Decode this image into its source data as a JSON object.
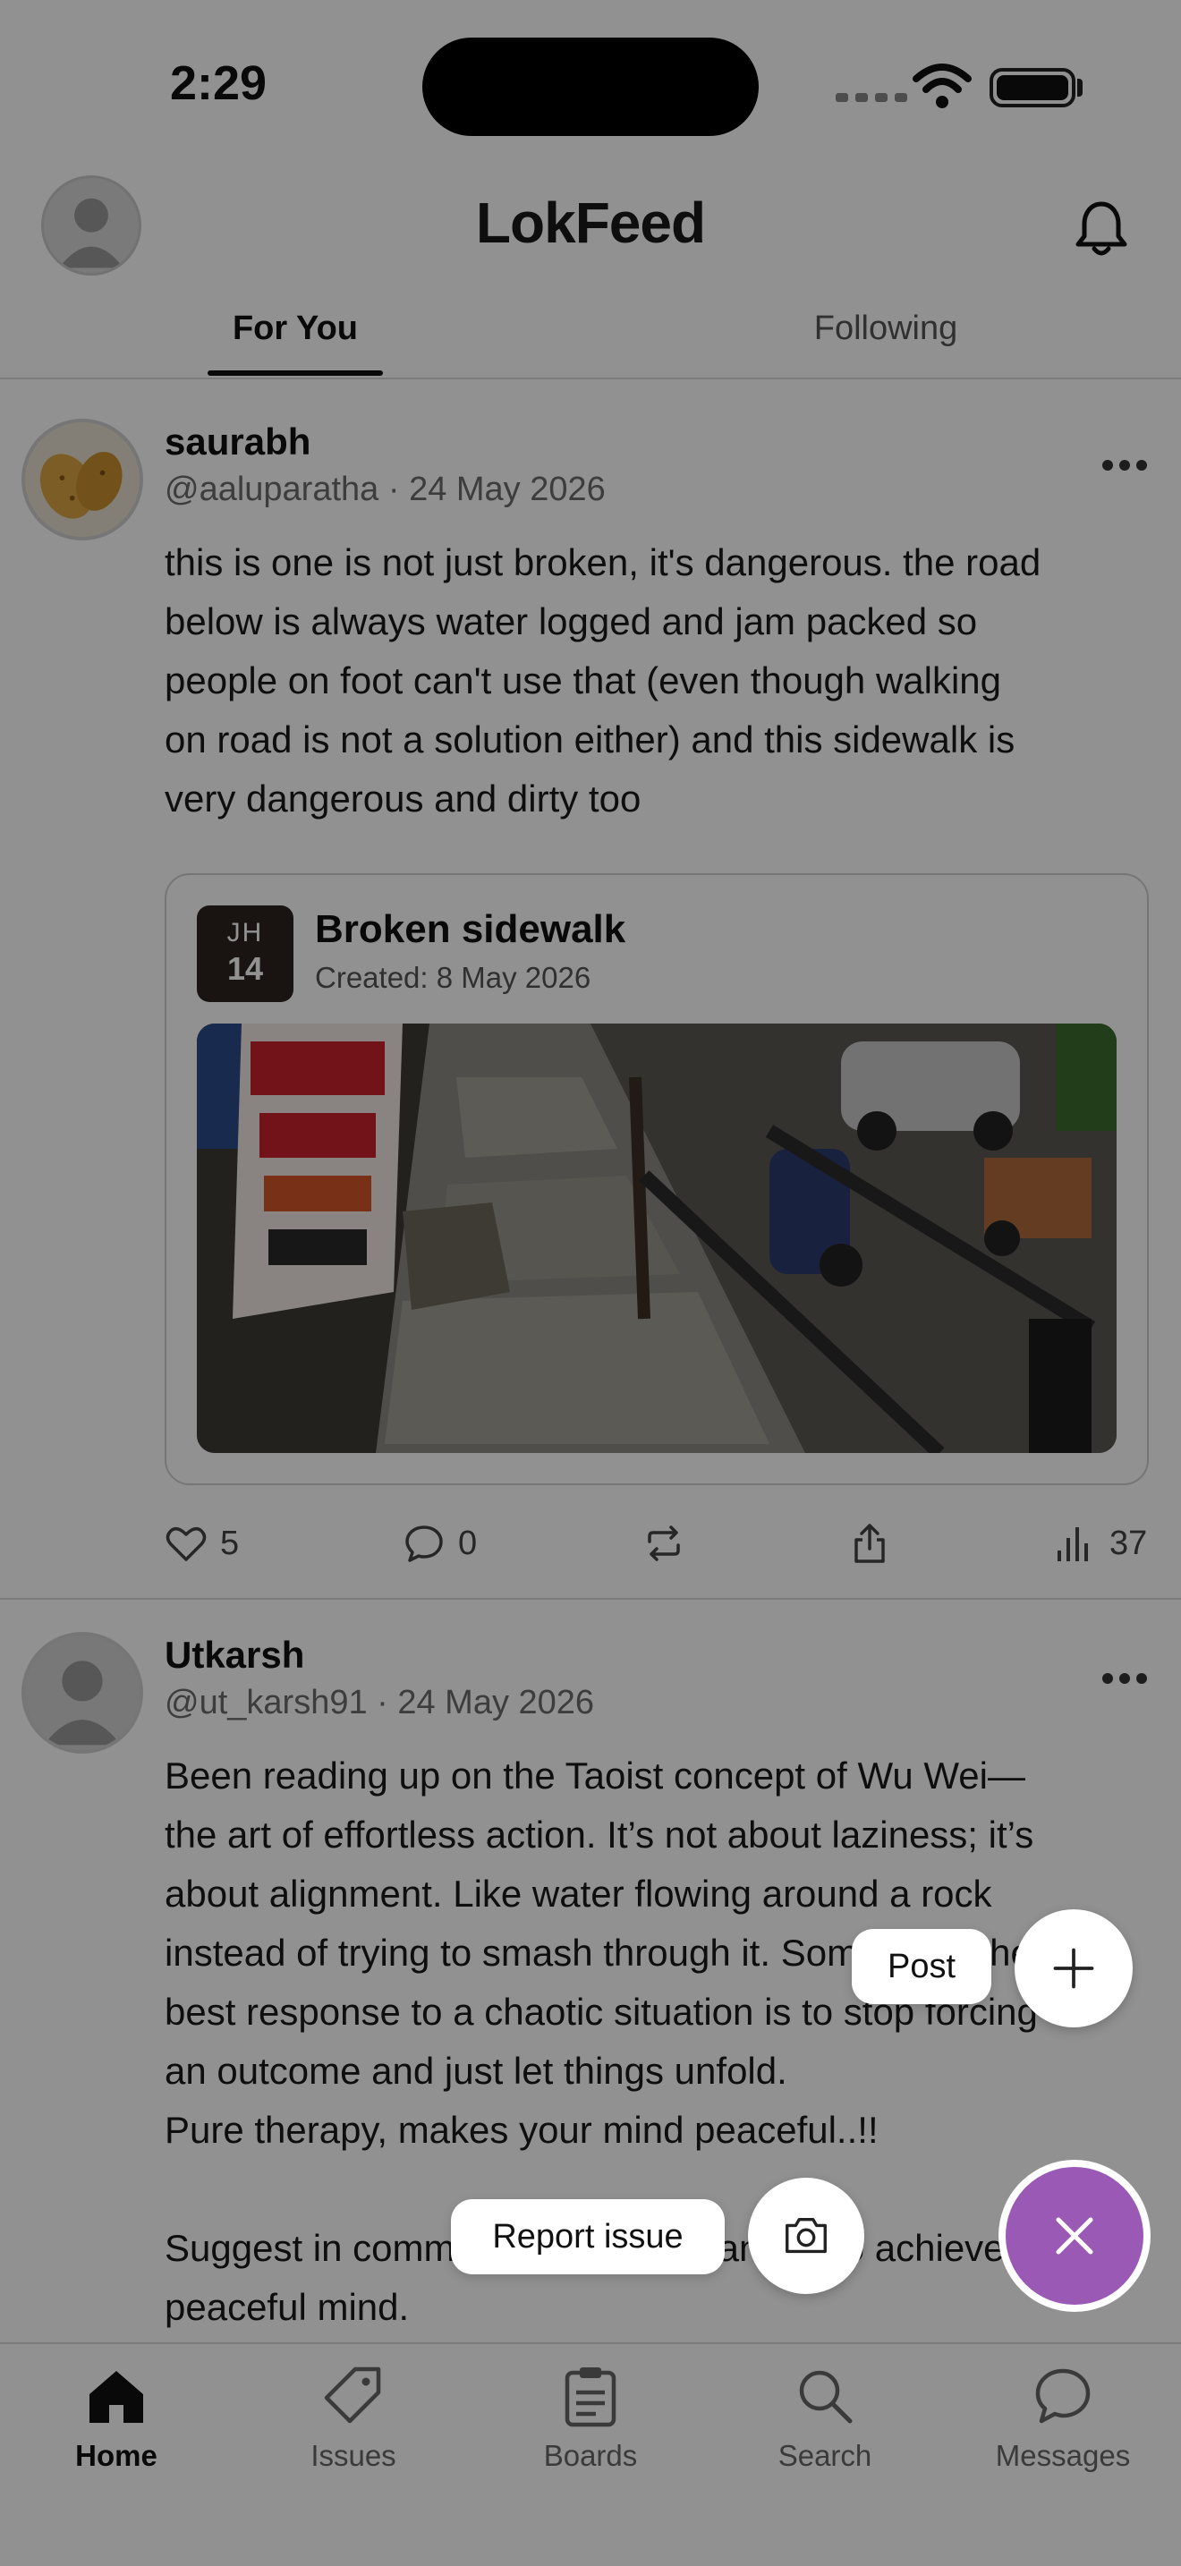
{
  "status_bar": {
    "time": "2:29"
  },
  "header": {
    "title": "LokFeed"
  },
  "tabs": [
    {
      "label": "For You",
      "active": true
    },
    {
      "label": "Following",
      "active": false
    }
  ],
  "posts": [
    {
      "display_name": "saurabh",
      "handle_date": "@aaluparatha · 24 May 2026",
      "body": "this is one is not just broken, it's dangerous. the road\nbelow is always water logged and jam packed so\npeople on foot can't use that (even though walking\non road is not a solution either) and this sidewalk is\nvery dangerous and dirty too",
      "issue": {
        "tag_letters": "JH",
        "tag_number": "14",
        "title": "Broken sidewalk",
        "created": "Created: 8 May 2026"
      },
      "actions": {
        "likes": "5",
        "comments": "0",
        "views": "37"
      }
    },
    {
      "display_name": "Utkarsh",
      "handle_date": "@ut_karsh91 · 24 May 2026",
      "body": "Been reading up on the Taoist concept of Wu Wei—\nthe art of effortless action. It’s not about laziness; it’s\nabout alignment. Like water flowing around a rock\ninstead of trying to smash through it. Sometimes the\nbest response to a chaotic situation is to stop forcing\nan outcome and just let things unfold.\nPure therapy, makes your mind peaceful..!!\n\nSuggest in comments how you manage to achieve a\npeaceful mind."
    }
  ],
  "fab_menu": {
    "post_label": "Post",
    "report_label": "Report issue"
  },
  "bottom_nav": [
    {
      "label": "Home",
      "active": true
    },
    {
      "label": "Issues",
      "active": false
    },
    {
      "label": "Boards",
      "active": false
    },
    {
      "label": "Search",
      "active": false
    },
    {
      "label": "Messages",
      "active": false
    }
  ],
  "colors": {
    "accent": "#9b59b6",
    "overlay": "rgba(0,0,0,0.43)"
  },
  "icons": [
    "bell-icon",
    "heart-icon",
    "comment-icon",
    "repost-icon",
    "share-icon",
    "views-icon",
    "plus-icon",
    "camera-icon",
    "close-icon",
    "home-icon",
    "tag-icon",
    "clipboard-icon",
    "search-icon",
    "message-icon"
  ]
}
